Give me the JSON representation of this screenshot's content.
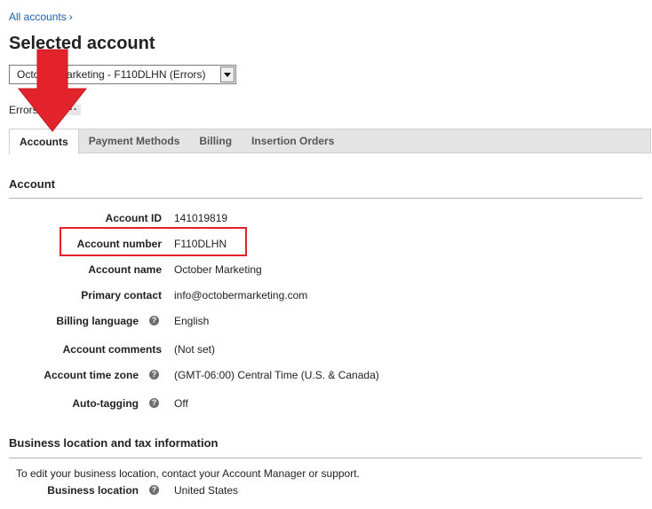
{
  "breadcrumb": {
    "all_accounts": "All accounts",
    "chevron": "›"
  },
  "page": {
    "title": "Selected account"
  },
  "account_selector": {
    "value": "October Marketing - F110DLHN (Errors)"
  },
  "errors": {
    "label": "Errors",
    "more": "···"
  },
  "tabs": [
    {
      "label": "Accounts",
      "active": true
    },
    {
      "label": "Payment Methods",
      "active": false
    },
    {
      "label": "Billing",
      "active": false
    },
    {
      "label": "Insertion Orders",
      "active": false
    }
  ],
  "account_section": {
    "title": "Account",
    "fields": {
      "account_id": {
        "label": "Account ID",
        "value": "141019819"
      },
      "account_number": {
        "label": "Account number",
        "value": "F110DLHN"
      },
      "account_name": {
        "label": "Account name",
        "value": "October Marketing"
      },
      "primary_contact": {
        "label": "Primary contact",
        "value": "info@octobermarketing.com"
      },
      "billing_language": {
        "label": "Billing language",
        "value": "English",
        "help": "?"
      },
      "account_comments": {
        "label": "Account comments",
        "value": "(Not set)"
      },
      "account_time_zone": {
        "label": "Account time zone",
        "value": "(GMT-06:00) Central Time (U.S. & Canada)",
        "help": "?"
      },
      "auto_tagging": {
        "label": "Auto-tagging",
        "value": "Off",
        "help": "?"
      }
    }
  },
  "business_section": {
    "title": "Business location and tax information",
    "note": "To edit your business location, contact your Account Manager or support.",
    "business_location": {
      "label": "Business location",
      "value": "United States",
      "help": "?"
    }
  },
  "colors": {
    "link": "#1a5faa",
    "annotation_red": "#e3232c",
    "tab_bar": "#e4e4e4"
  },
  "icons": {
    "help": "help-circle-icon",
    "dropdown": "dropdown-arrow-icon",
    "annotation": "red-down-arrow-icon"
  }
}
